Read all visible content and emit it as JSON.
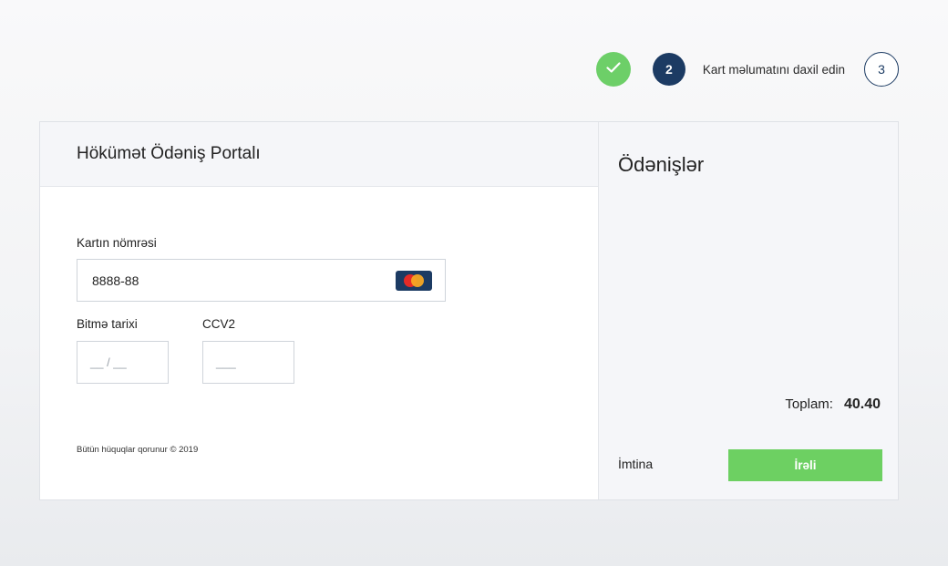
{
  "stepper": {
    "step1_icon": "check-icon",
    "step2_number": "2",
    "step2_label": "Kart məlumatını daxil edin",
    "step3_number": "3"
  },
  "form": {
    "title": "Hökümət Ödəniş Portalı",
    "card_number_label": "Kartın nömrəsi",
    "card_number_value": "8888-88",
    "card_brand_icon": "mastercard-icon",
    "expiry_label": "Bitmə tarixi",
    "expiry_placeholder": "__ / __",
    "ccv_label": "CCV2",
    "ccv_placeholder": "___",
    "copyright": "Bütün hüquqlar qorunur © 2019"
  },
  "summary": {
    "title": "Ödənişlər",
    "total_label": "Toplam:",
    "total_value": "40.40",
    "cancel_label": "İmtina",
    "next_label": "İrəli"
  },
  "colors": {
    "accent_green": "#6dd062",
    "navy": "#1c3b63"
  }
}
